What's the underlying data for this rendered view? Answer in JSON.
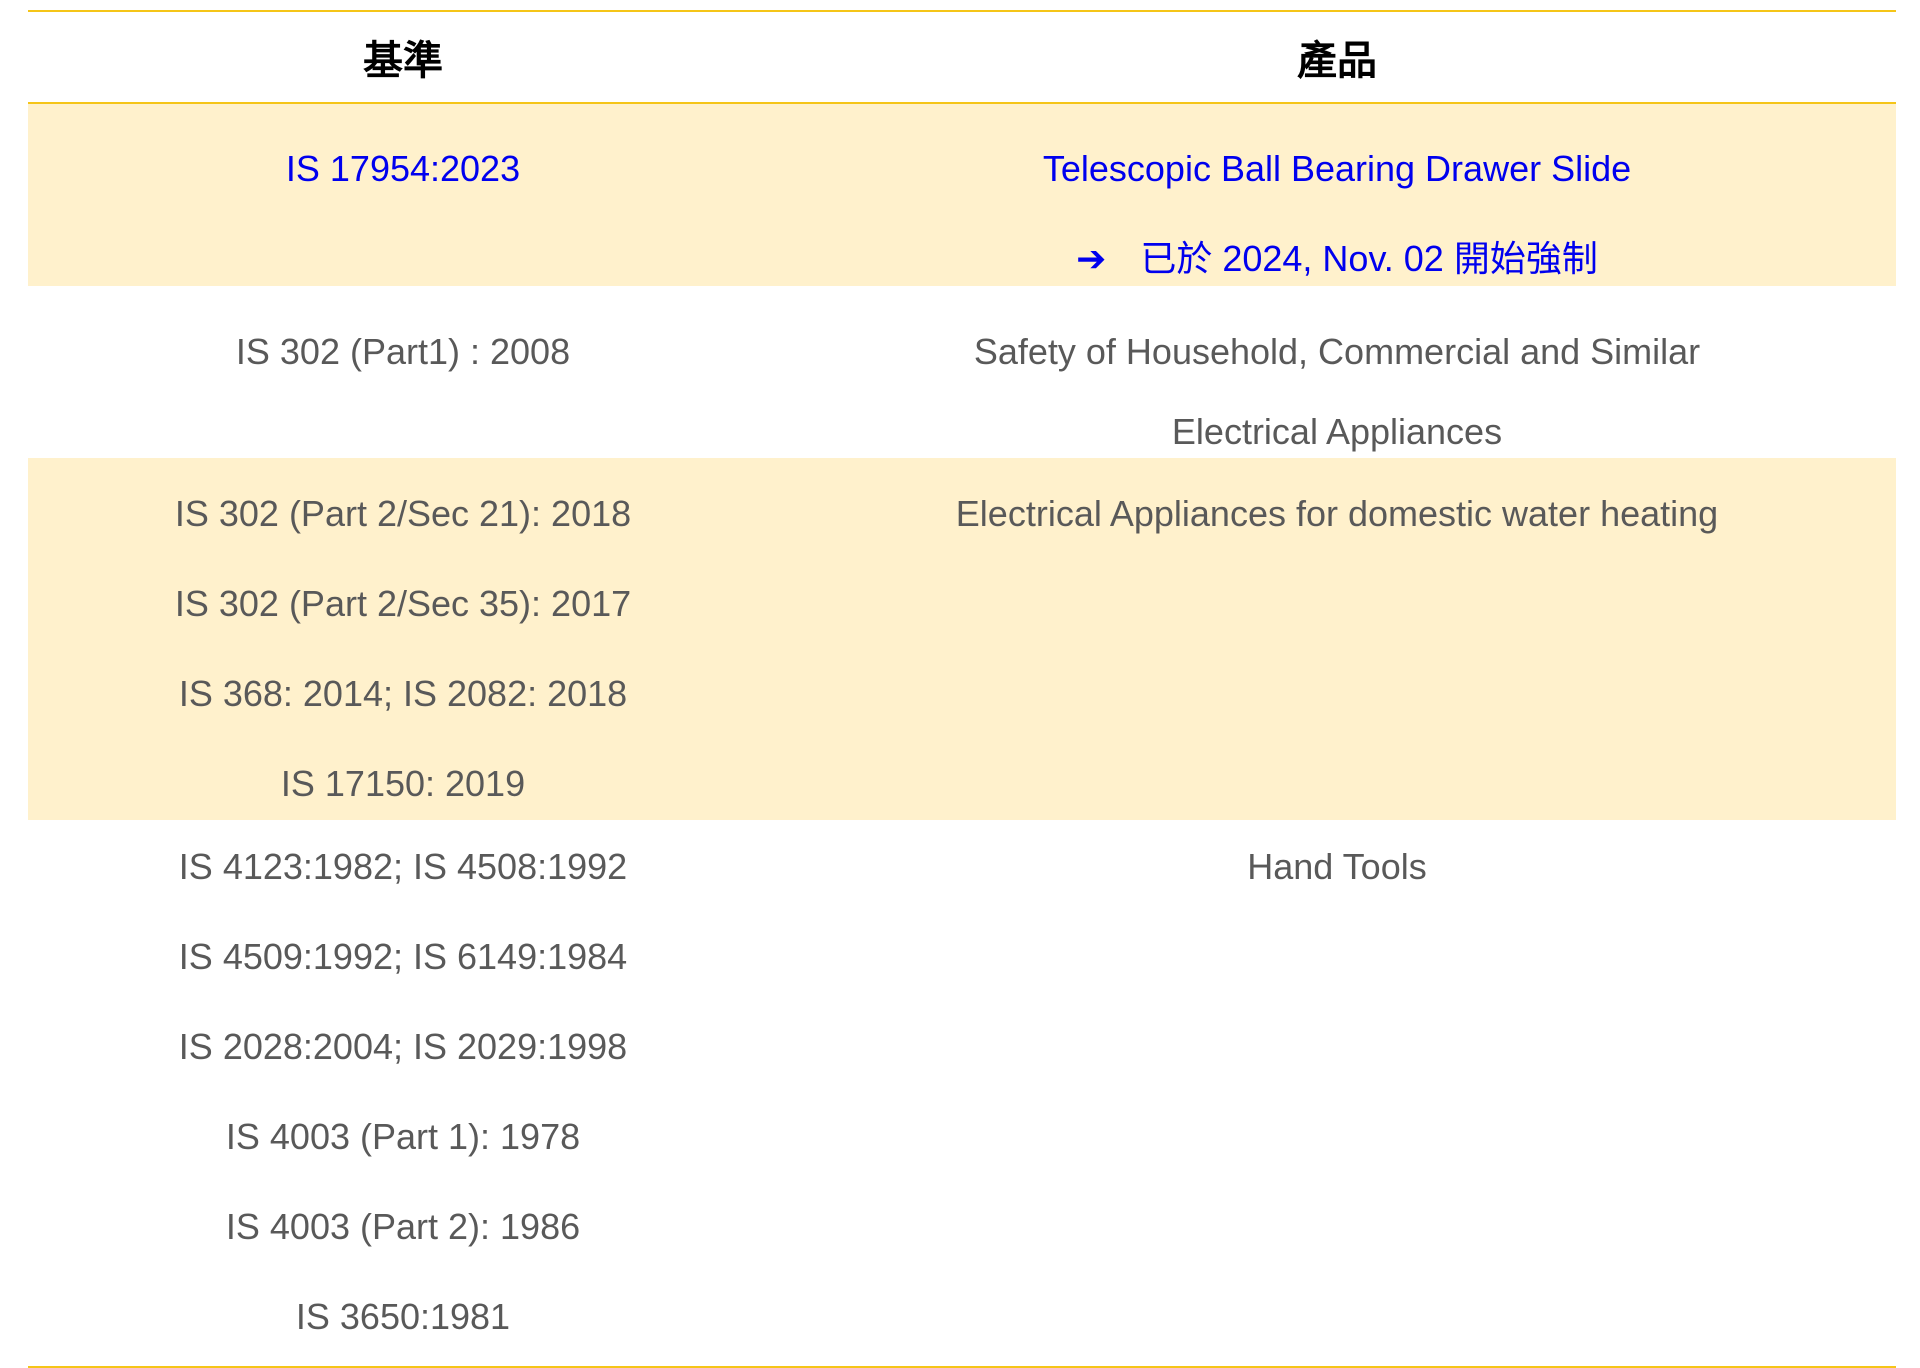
{
  "header": {
    "standard": "基準",
    "product": "產品"
  },
  "rows": [
    {
      "standards": [
        "IS 17954:2023"
      ],
      "products": [
        "Telescopic Ball Bearing Drawer Slide"
      ],
      "note": "已於 2024, Nov. 02 開始強制",
      "arrow": "➔",
      "highlight": true
    },
    {
      "standards": [
        "IS 302 (Part1) : 2008"
      ],
      "products": [
        "Safety of Household, Commercial and Similar",
        "Electrical Appliances"
      ]
    },
    {
      "standards": [
        "IS 302 (Part 2/Sec 21): 2018",
        "IS 302 (Part 2/Sec 35): 2017",
        "IS 368: 2014; IS 2082: 2018",
        "IS 17150: 2019"
      ],
      "products": [
        "Electrical Appliances for domestic water heating"
      ]
    },
    {
      "standards": [
        "IS 4123:1982; IS 4508:1992",
        "IS 4509:1992; IS 6149:1984",
        "IS 2028:2004; IS 2029:1998",
        "IS 4003 (Part 1): 1978",
        "IS 4003 (Part 2): 1986",
        "IS 3650:1981"
      ],
      "products": [
        "Hand Tools"
      ]
    }
  ],
  "colors": {
    "border": "#f5c518",
    "band": "#fff1cc",
    "text": "#595959",
    "highlight_text": "#0000ee"
  }
}
